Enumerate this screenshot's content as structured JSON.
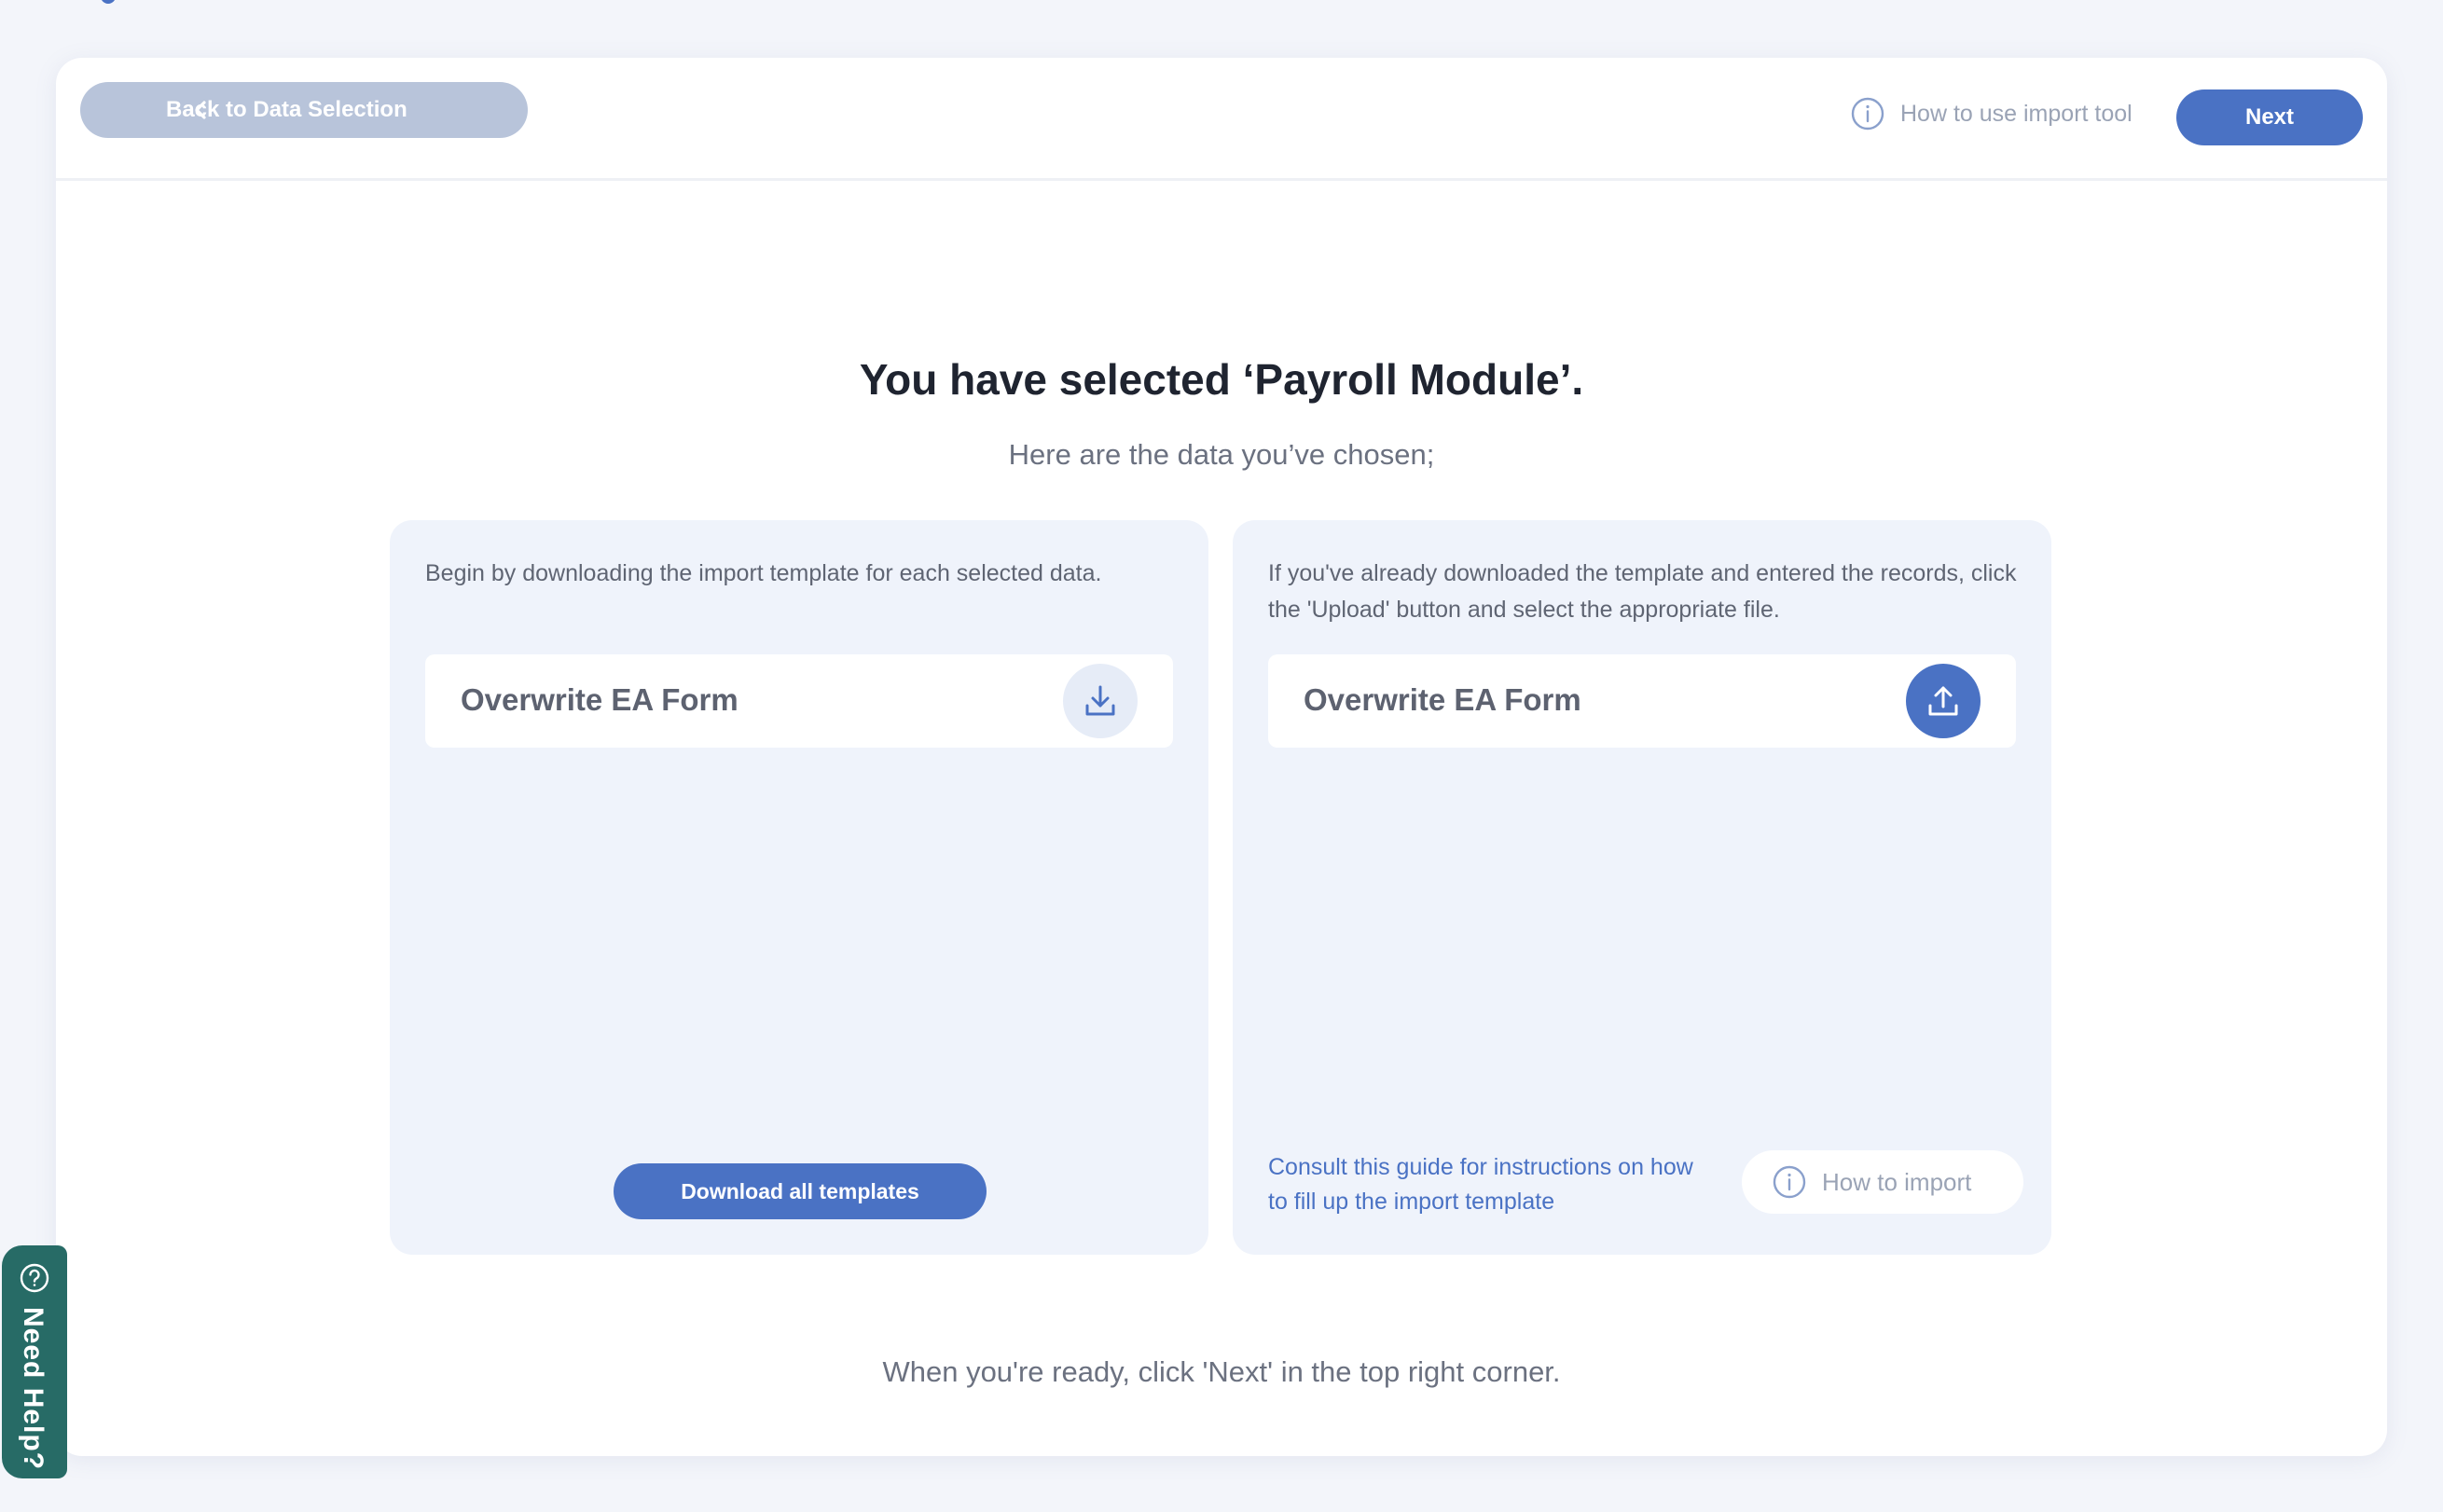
{
  "toolbar": {
    "back_label": "Back to Data Selection",
    "help_label": "How to use import tool",
    "next_label": "Next"
  },
  "main": {
    "headline": "You have selected ‘Payroll Module’.",
    "subhead": "Here are the data you’ve chosen;",
    "footer_note": "When you're ready, click 'Next' in the top right corner."
  },
  "download_panel": {
    "description": "Begin by downloading the import template for each selected data.",
    "item_label": "Overwrite EA Form",
    "download_all_label": "Download all templates"
  },
  "upload_panel": {
    "description": "If you've already downloaded the template and entered the records, click the 'Upload' button and select the appropriate file.",
    "item_label": "Overwrite EA Form",
    "guide_text": "Consult this guide for instructions on how to fill up the import template",
    "how_import_label": "How to import"
  },
  "help_tab": {
    "label": "Need Help?"
  },
  "icons": {
    "back": "chevron-left-icon",
    "help": "info-icon",
    "download": "download-icon",
    "upload": "upload-icon",
    "need_help": "question-icon"
  },
  "colors": {
    "accent": "#4a72c4",
    "disabled_button": "#b8c4da",
    "panel_bg": "#eff3fb",
    "help_tab": "#276b66",
    "page_bg": "#f3f5fa"
  }
}
